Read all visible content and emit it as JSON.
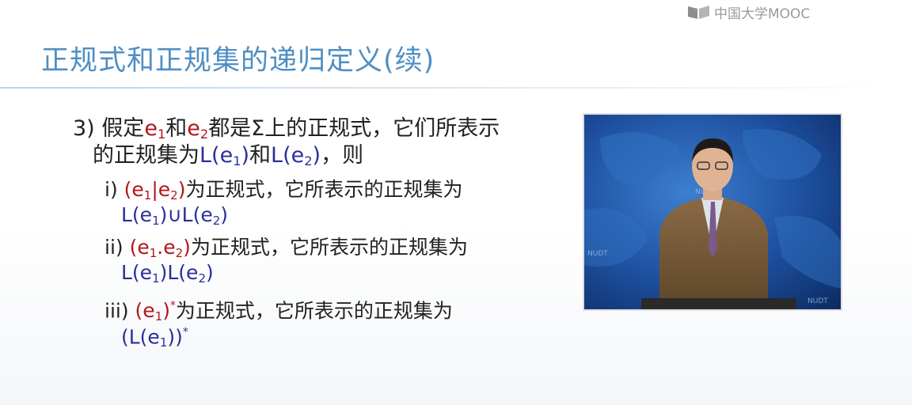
{
  "brand": {
    "text": "中国大学MOOC"
  },
  "title": "正规式和正规集的递归定义(续)",
  "rule3": {
    "num": "3)",
    "p1": "假定",
    "e1": "e",
    "s1": "1",
    "p2": "和",
    "e2": "e",
    "s2": "2",
    "p3": "都是Σ上的正规式，它们所表示",
    "p4": "的正规集为",
    "L1": "L(e",
    "L1s": "1",
    "L1c": ")",
    "p5": "和",
    "L2": "L(e",
    "L2s": "2",
    "L2c": ")",
    "p6": "，则"
  },
  "item_i": {
    "num": "i)",
    "expr_a": "(e",
    "sa": "1",
    "op": "|e",
    "sb": "2",
    "close": ")",
    "text": "为正规式，它所表示的正规集为",
    "set_a": "L(e",
    "set_sa": "1",
    "set_mid": ")∪L(e",
    "set_sb": "2",
    "set_close": ")"
  },
  "item_ii": {
    "num": "ii)",
    "expr_a": "(e",
    "sa": "1",
    "op": ".e",
    "sb": "2",
    "close": ")",
    "text": "为正规式，它所表示的正规集为",
    "set_a": "L(e",
    "set_sa": "1",
    "set_mid": ")L(e",
    "set_sb": "2",
    "set_close": ")"
  },
  "item_iii": {
    "num": "iii)",
    "expr_a": "(e",
    "sa": "1",
    "close": ")",
    "star": "*",
    "text": "为正规式，它所表示的正规集为",
    "set_a": "(L(e",
    "set_sa": "1",
    "set_close": "))",
    "set_star": "*"
  },
  "video": {
    "watermark": "NUDT"
  },
  "colors": {
    "title": "#4f8fc4",
    "expr": "#b3161b",
    "set": "#2a2f9c",
    "body": "#222222"
  }
}
